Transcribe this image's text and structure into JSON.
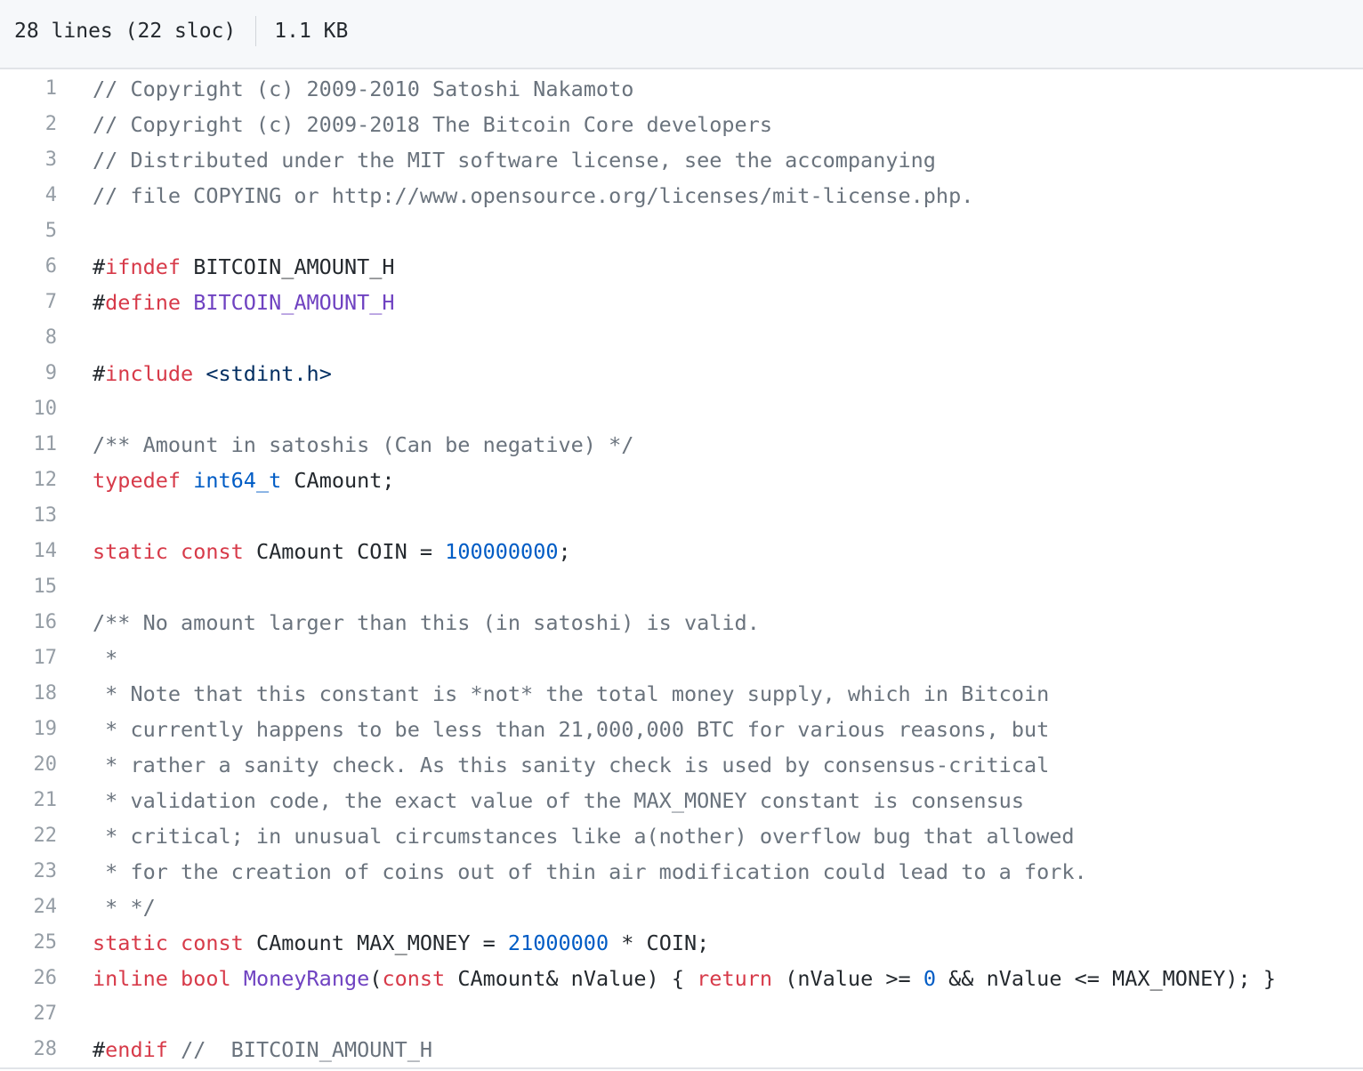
{
  "file_info": {
    "lines": "28 lines (22 sloc)",
    "size": "1.1 KB"
  },
  "code_lines": [
    {
      "number": "1",
      "tokens": [
        {
          "t": "// Copyright (c) 2009-2010 Satoshi Nakamoto",
          "c": "comment"
        }
      ]
    },
    {
      "number": "2",
      "tokens": [
        {
          "t": "// Copyright (c) 2009-2018 The Bitcoin Core developers",
          "c": "comment"
        }
      ]
    },
    {
      "number": "3",
      "tokens": [
        {
          "t": "// Distributed under the MIT software license, see the accompanying",
          "c": "comment"
        }
      ]
    },
    {
      "number": "4",
      "tokens": [
        {
          "t": "// file COPYING or http://www.opensource.org/licenses/mit-license.php.",
          "c": "comment"
        }
      ]
    },
    {
      "number": "5",
      "tokens": []
    },
    {
      "number": "6",
      "tokens": [
        {
          "t": "#",
          "c": "plain"
        },
        {
          "t": "ifndef",
          "c": "kw"
        },
        {
          "t": " BITCOIN_AMOUNT_H",
          "c": "plain"
        }
      ]
    },
    {
      "number": "7",
      "tokens": [
        {
          "t": "#",
          "c": "plain"
        },
        {
          "t": "define",
          "c": "kw"
        },
        {
          "t": " ",
          "c": "plain"
        },
        {
          "t": "BITCOIN_AMOUNT_H",
          "c": "ent"
        }
      ]
    },
    {
      "number": "8",
      "tokens": []
    },
    {
      "number": "9",
      "tokens": [
        {
          "t": "#",
          "c": "plain"
        },
        {
          "t": "include",
          "c": "kw"
        },
        {
          "t": " ",
          "c": "plain"
        },
        {
          "t": "<stdint.h>",
          "c": "str"
        }
      ]
    },
    {
      "number": "10",
      "tokens": []
    },
    {
      "number": "11",
      "tokens": [
        {
          "t": "/** Amount in satoshis (Can be negative) */",
          "c": "comment"
        }
      ]
    },
    {
      "number": "12",
      "tokens": [
        {
          "t": "typedef",
          "c": "kw"
        },
        {
          "t": " ",
          "c": "plain"
        },
        {
          "t": "int64_t",
          "c": "const"
        },
        {
          "t": " CAmount;",
          "c": "plain"
        }
      ]
    },
    {
      "number": "13",
      "tokens": []
    },
    {
      "number": "14",
      "tokens": [
        {
          "t": "static",
          "c": "kw"
        },
        {
          "t": " ",
          "c": "plain"
        },
        {
          "t": "const",
          "c": "kw"
        },
        {
          "t": " CAmount COIN = ",
          "c": "plain"
        },
        {
          "t": "100000000",
          "c": "const"
        },
        {
          "t": ";",
          "c": "plain"
        }
      ]
    },
    {
      "number": "15",
      "tokens": []
    },
    {
      "number": "16",
      "tokens": [
        {
          "t": "/** No amount larger than this (in satoshi) is valid.",
          "c": "comment"
        }
      ]
    },
    {
      "number": "17",
      "tokens": [
        {
          "t": " *",
          "c": "comment"
        }
      ]
    },
    {
      "number": "18",
      "tokens": [
        {
          "t": " * Note that this constant is *not* the total money supply, which in Bitcoin",
          "c": "comment"
        }
      ]
    },
    {
      "number": "19",
      "tokens": [
        {
          "t": " * currently happens to be less than 21,000,000 BTC for various reasons, but",
          "c": "comment"
        }
      ]
    },
    {
      "number": "20",
      "tokens": [
        {
          "t": " * rather a sanity check. As this sanity check is used by consensus-critical",
          "c": "comment"
        }
      ]
    },
    {
      "number": "21",
      "tokens": [
        {
          "t": " * validation code, the exact value of the MAX_MONEY constant is consensus",
          "c": "comment"
        }
      ]
    },
    {
      "number": "22",
      "tokens": [
        {
          "t": " * critical; in unusual circumstances like a(nother) overflow bug that allowed",
          "c": "comment"
        }
      ]
    },
    {
      "number": "23",
      "tokens": [
        {
          "t": " * for the creation of coins out of thin air modification could lead to a fork.",
          "c": "comment"
        }
      ]
    },
    {
      "number": "24",
      "tokens": [
        {
          "t": " * */",
          "c": "comment"
        }
      ]
    },
    {
      "number": "25",
      "tokens": [
        {
          "t": "static",
          "c": "kw"
        },
        {
          "t": " ",
          "c": "plain"
        },
        {
          "t": "const",
          "c": "kw"
        },
        {
          "t": " CAmount MAX_MONEY = ",
          "c": "plain"
        },
        {
          "t": "21000000",
          "c": "const"
        },
        {
          "t": " * COIN;",
          "c": "plain"
        }
      ]
    },
    {
      "number": "26",
      "tokens": [
        {
          "t": "inline",
          "c": "kw"
        },
        {
          "t": " ",
          "c": "plain"
        },
        {
          "t": "bool",
          "c": "kw"
        },
        {
          "t": " ",
          "c": "plain"
        },
        {
          "t": "MoneyRange",
          "c": "ent"
        },
        {
          "t": "(",
          "c": "plain"
        },
        {
          "t": "const",
          "c": "kw"
        },
        {
          "t": " CAmount& nValue) { ",
          "c": "plain"
        },
        {
          "t": "return",
          "c": "kw"
        },
        {
          "t": " (nValue >= ",
          "c": "plain"
        },
        {
          "t": "0",
          "c": "const"
        },
        {
          "t": " && nValue <= MAX_MONEY); }",
          "c": "plain"
        }
      ]
    },
    {
      "number": "27",
      "tokens": []
    },
    {
      "number": "28",
      "tokens": [
        {
          "t": "#",
          "c": "plain"
        },
        {
          "t": "endif",
          "c": "kw"
        },
        {
          "t": " ",
          "c": "plain"
        },
        {
          "t": "//  BITCOIN_AMOUNT_H",
          "c": "comment"
        }
      ]
    }
  ],
  "colors": {
    "comment": "#6a737d",
    "keyword": "#d73a49",
    "entity": "#6f42c1",
    "constant": "#005cc5",
    "string": "#032f62",
    "text": "#24292e",
    "line_number": "#959da5",
    "header_bg": "#f6f8fa"
  }
}
